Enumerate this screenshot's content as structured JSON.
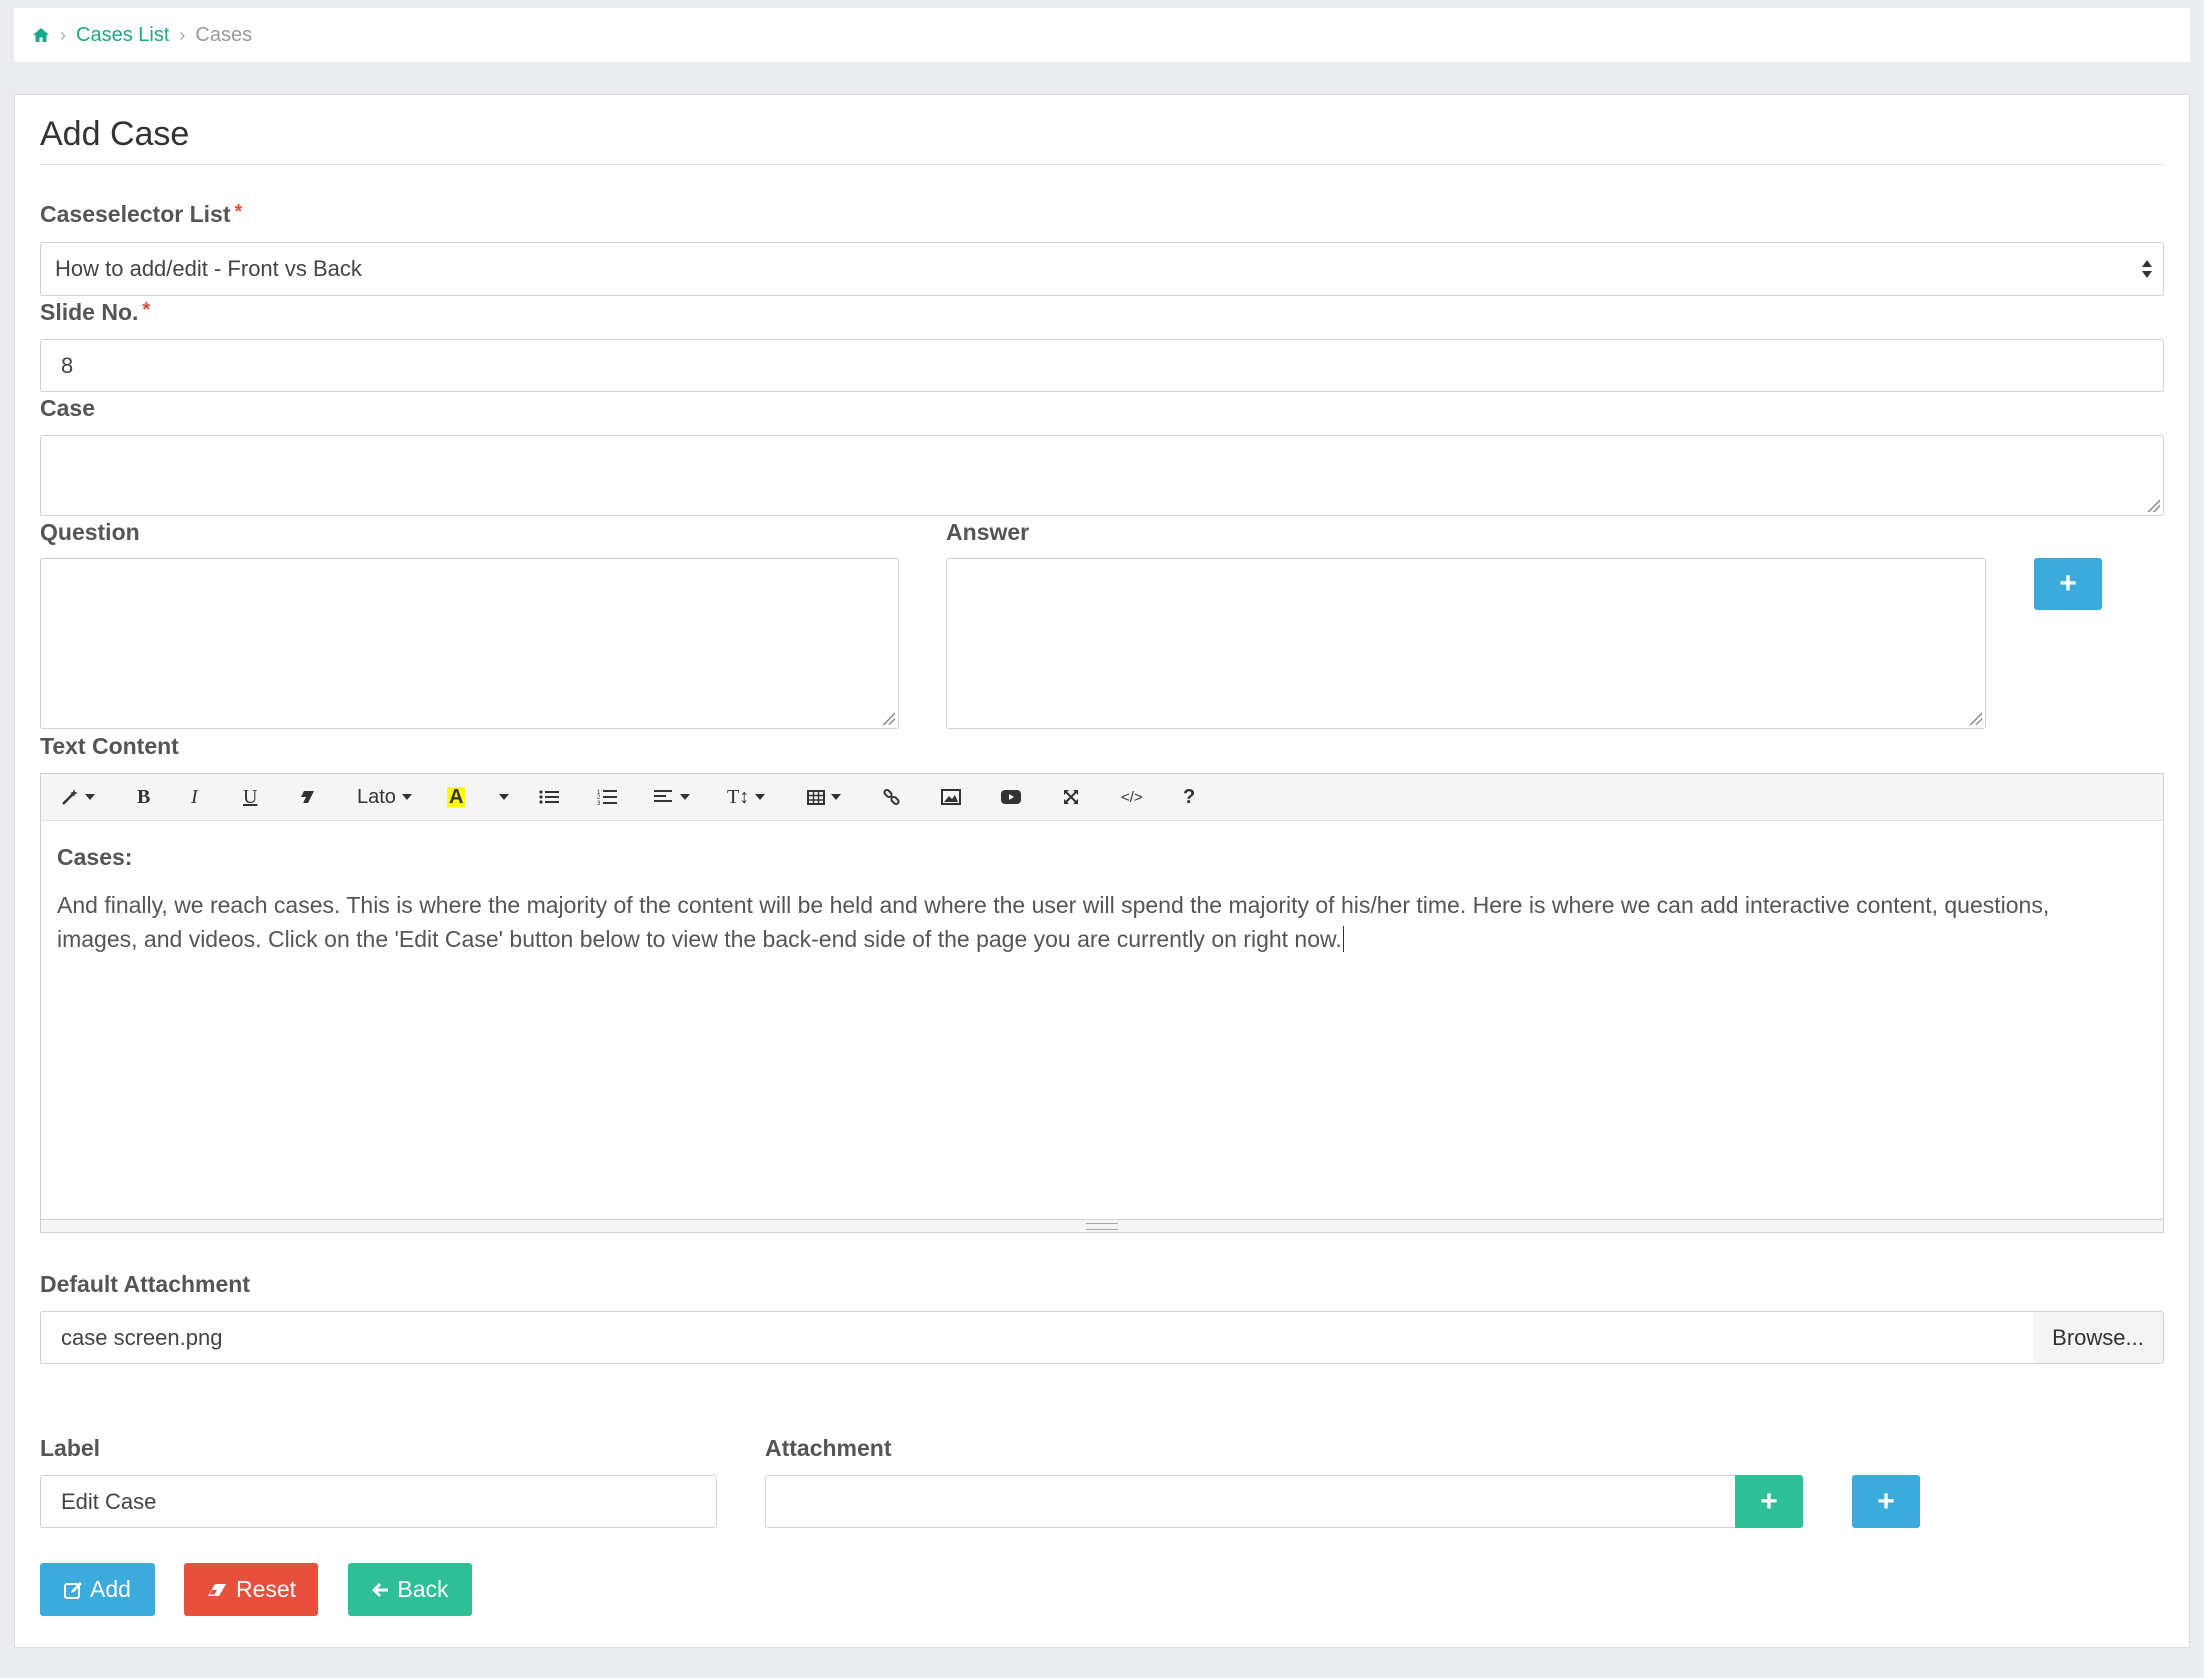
{
  "breadcrumb": {
    "home_icon": "home-icon",
    "items": [
      "Cases List",
      "Cases"
    ],
    "separator": "›"
  },
  "form": {
    "title": "Add Case",
    "caseselector": {
      "label": "Caseselector List",
      "required_mark": "*",
      "value": "How to add/edit - Front vs Back"
    },
    "slide": {
      "label": "Slide No.",
      "required_mark": "*",
      "value": "8"
    },
    "case": {
      "label": "Case",
      "value": ""
    },
    "question": {
      "label": "Question",
      "value": ""
    },
    "answer": {
      "label": "Answer",
      "value": ""
    },
    "text_content": {
      "label": "Text Content",
      "toolbar": {
        "style_icon": "magic-wand-icon",
        "bold": "B",
        "italic": "I",
        "underline": "U",
        "eraser_icon": "eraser-icon",
        "font": "Lato",
        "color": "A",
        "ul_icon": "unordered-list-icon",
        "ol_icon": "ordered-list-icon",
        "align_icon": "align-icon",
        "height": "T↕",
        "table_icon": "table-icon",
        "link_icon": "link-icon",
        "picture_icon": "picture-icon",
        "video_icon": "video-icon",
        "fullscreen_icon": "fullscreen-icon",
        "code_icon": "code-view-icon",
        "help": "?"
      },
      "heading": "Cases:",
      "body": "And finally, we reach cases. This is where the majority of the content will be held and where the user will spend the majority of his/her time. Here is where we can add interactive content, questions, images, and videos. Click on the 'Edit Case' button below to view the back-end side of the page you are currently on right now."
    },
    "default_attachment": {
      "label": "Default Attachment",
      "value": "case screen.png",
      "browse": "Browse..."
    },
    "label_field": {
      "label": "Label",
      "value": "Edit Case"
    },
    "attachment_field": {
      "label": "Attachment",
      "value": ""
    },
    "buttons": {
      "add": "Add",
      "reset": "Reset",
      "back": "Back"
    }
  },
  "colors": {
    "primary": "#3aabdb",
    "success": "#2ebf96",
    "danger": "#e8503e",
    "link": "#19a98a",
    "required": "#e74c3c"
  }
}
